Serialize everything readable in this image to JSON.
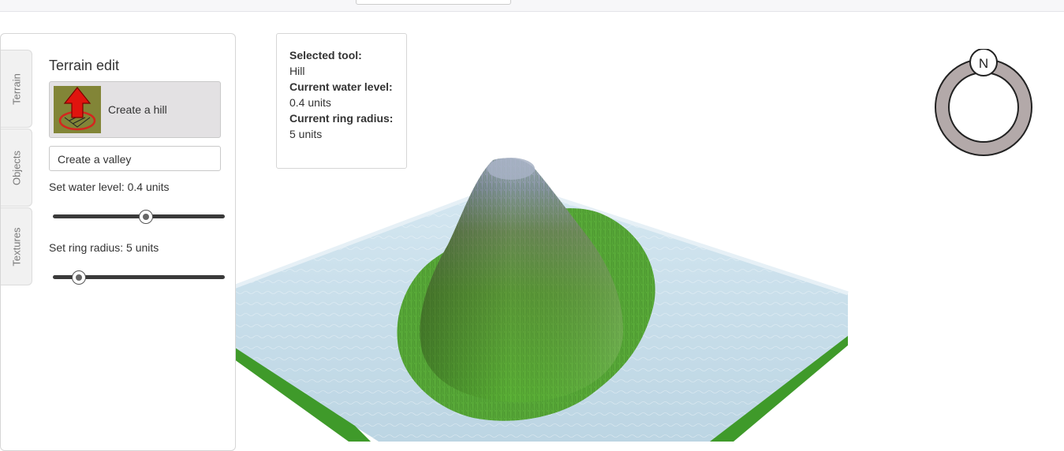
{
  "panel": {
    "tabs": [
      {
        "label": "Terrain"
      },
      {
        "label": "Objects"
      },
      {
        "label": "Textures"
      }
    ],
    "title": "Terrain edit",
    "tools": {
      "hill_label": "Create a hill",
      "valley_label": "Create a valley"
    },
    "water_slider": {
      "label": "Set water level: 0.4 units",
      "fraction": 0.54
    },
    "radius_slider": {
      "label": "Set ring radius: 5 units",
      "fraction": 0.15
    }
  },
  "info": {
    "tool_heading": "Selected tool:",
    "tool_value": "Hill",
    "water_heading": "Current water level:",
    "water_value": "0.4 units",
    "radius_heading": "Current ring radius:",
    "radius_value": "5 units"
  },
  "compass": {
    "north_label": "N"
  },
  "colors": {
    "water": "#c6dce8",
    "grass": "#5aa83a",
    "compass_ring": "#b3a9a9"
  }
}
